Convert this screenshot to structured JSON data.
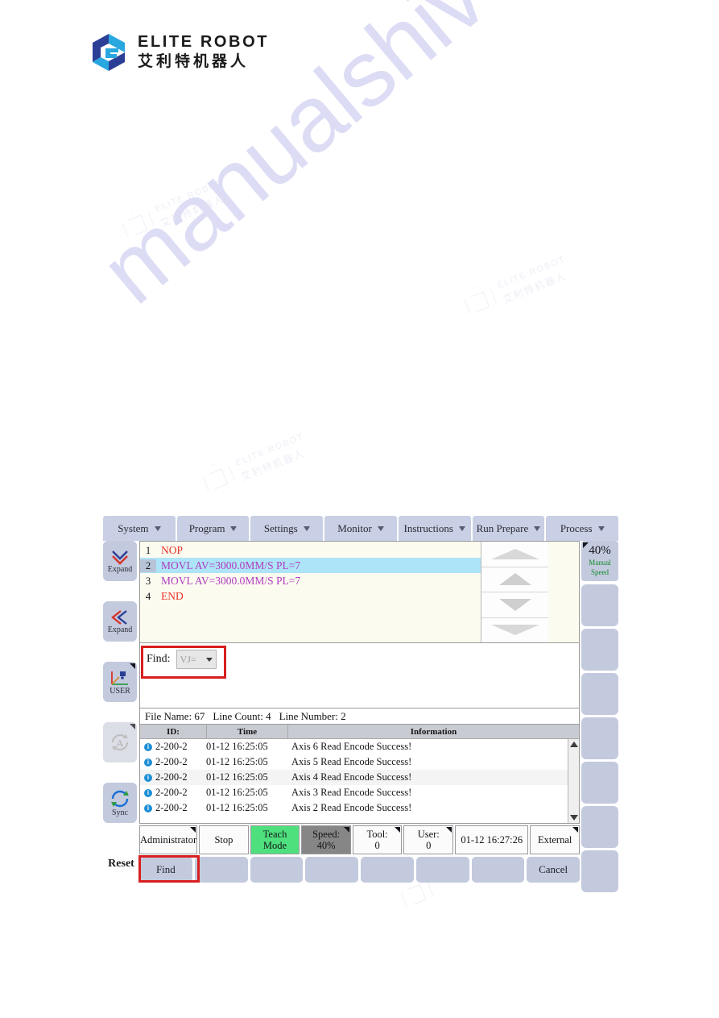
{
  "brand": {
    "name_en": "ELITE ROBOT",
    "name_cn": "艾利特机器人"
  },
  "watermarks": {
    "site": "manualshive.com",
    "logo_en": "ELITE ROBOT",
    "logo_cn": "艾利特机器人"
  },
  "menubar": [
    {
      "label": "System"
    },
    {
      "label": "Program"
    },
    {
      "label": "Settings"
    },
    {
      "label": "Monitor"
    },
    {
      "label": "Instructions"
    },
    {
      "label": "Run Prepare"
    },
    {
      "label": "Process"
    }
  ],
  "sidebar": [
    {
      "label": "Expand",
      "icon": "chevron-down-expand-icon"
    },
    {
      "label": "Expand",
      "icon": "chevron-left-expand-icon"
    },
    {
      "label": "USER",
      "icon": "coordinate-frame-icon"
    },
    {
      "label": "",
      "icon": "auto-mode-icon"
    },
    {
      "label": "Sync",
      "icon": "sync-icon"
    },
    {
      "label": "Reset",
      "icon": "reset-label"
    }
  ],
  "program": {
    "lines": [
      {
        "number": "1",
        "code": "NOP",
        "color": "red",
        "selected": false
      },
      {
        "number": "2",
        "code": "MOVL AV=3000.0MM/S PL=7",
        "color": "magenta",
        "selected": true
      },
      {
        "number": "3",
        "code": "MOVL AV=3000.0MM/S PL=7",
        "color": "magenta",
        "selected": false
      },
      {
        "number": "4",
        "code": "END",
        "color": "red",
        "selected": false
      }
    ]
  },
  "find": {
    "label": "Find:",
    "value": "VJ=",
    "placeholder": "VJ="
  },
  "file_info": {
    "file_name": "File Name: 67",
    "line_count": "Line Count: 4",
    "line_number": "Line Number: 2"
  },
  "log": {
    "columns": [
      "ID:",
      "Time",
      "Information"
    ],
    "rows": [
      {
        "id": "2-200-2",
        "time": "01-12 16:25:05",
        "info": "Axis 6 Read Encode Success!"
      },
      {
        "id": "2-200-2",
        "time": "01-12 16:25:05",
        "info": "Axis 5 Read Encode Success!"
      },
      {
        "id": "2-200-2",
        "time": "01-12 16:25:05",
        "info": "Axis 4 Read Encode Success!"
      },
      {
        "id": "2-200-2",
        "time": "01-12 16:25:05",
        "info": "Axis 3 Read Encode Success!"
      },
      {
        "id": "2-200-2",
        "time": "01-12 16:25:05",
        "info": "Axis 2 Read Encode Success!"
      }
    ]
  },
  "statusbar": [
    {
      "line1": "Administrator",
      "line2": "",
      "style": "plain"
    },
    {
      "line1": "Stop",
      "line2": "",
      "style": "plain"
    },
    {
      "line1": "Teach",
      "line2": "Mode",
      "style": "green"
    },
    {
      "line1": "Speed:",
      "line2": "40%",
      "style": "grey"
    },
    {
      "line1": "Tool:",
      "line2": "0",
      "style": "plain"
    },
    {
      "line1": "User:",
      "line2": "0",
      "style": "plain"
    },
    {
      "line1": "01-12 16:27:26",
      "line2": "",
      "style": "plain"
    },
    {
      "line1": "External",
      "line2": "",
      "style": "plain"
    }
  ],
  "function_keys": [
    {
      "label": "Find"
    },
    {
      "label": ""
    },
    {
      "label": ""
    },
    {
      "label": ""
    },
    {
      "label": ""
    },
    {
      "label": ""
    },
    {
      "label": ""
    },
    {
      "label": "Cancel"
    }
  ],
  "manual_speed": {
    "percent": "40%",
    "line1": "Manual",
    "line2": "Speed"
  },
  "colors": {
    "highlight_red": "#d81f1f",
    "selection_blue": "#aee4f7",
    "teach_green": "#4fe07e",
    "speed_grey": "#868686",
    "panel_blue": "#c3cade"
  }
}
